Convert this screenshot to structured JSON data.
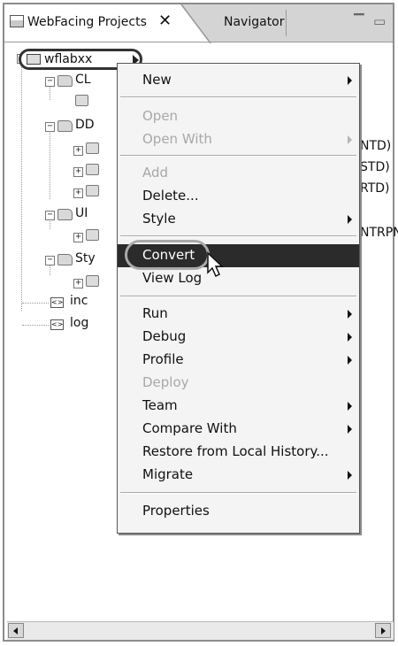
{
  "tabs": {
    "active_label": "WebFacing Projects",
    "close_glyph": "✕",
    "inactive_label": "Navigator",
    "minimize_glyph": "▔",
    "maximize_glyph": "▭"
  },
  "tree": {
    "root_label": "wflabxx",
    "nodes": [
      {
        "label": "CL",
        "icon": "cl-folder-icon"
      },
      {
        "label": "DD",
        "icon": "dds-folder-icon"
      },
      {
        "label": "UI",
        "icon": "ui-folder-icon"
      },
      {
        "label": "Sty",
        "icon": "style-folder-icon"
      },
      {
        "label": "inc",
        "icon": "file-icon"
      },
      {
        "label": "log",
        "icon": "file-icon"
      }
    ],
    "right_fragments": [
      "NTD)",
      "STD)",
      "RTD)",
      "NTRPN"
    ]
  },
  "context_menu": {
    "items": [
      {
        "label": "New",
        "submenu": true,
        "enabled": true
      },
      {
        "label": "Open",
        "submenu": false,
        "enabled": false
      },
      {
        "label": "Open With",
        "submenu": true,
        "enabled": false
      },
      {
        "label": "Add",
        "submenu": false,
        "enabled": false
      },
      {
        "label": "Delete...",
        "submenu": false,
        "enabled": true
      },
      {
        "label": "Style",
        "submenu": true,
        "enabled": true
      },
      {
        "label": "Convert",
        "submenu": false,
        "enabled": true,
        "selected": true
      },
      {
        "label": "View Log",
        "submenu": false,
        "enabled": true
      },
      {
        "label": "Run",
        "submenu": true,
        "enabled": true
      },
      {
        "label": "Debug",
        "submenu": true,
        "enabled": true
      },
      {
        "label": "Profile",
        "submenu": true,
        "enabled": true
      },
      {
        "label": "Deploy",
        "submenu": false,
        "enabled": false
      },
      {
        "label": "Team",
        "submenu": true,
        "enabled": true
      },
      {
        "label": "Compare With",
        "submenu": true,
        "enabled": true
      },
      {
        "label": "Restore from Local History...",
        "submenu": false,
        "enabled": true
      },
      {
        "label": "Migrate",
        "submenu": true,
        "enabled": true
      },
      {
        "label": "Properties",
        "submenu": false,
        "enabled": true
      }
    ]
  },
  "colors": {
    "selection_bg": "#2b2b2b",
    "menu_bg": "#f4f4f4",
    "disabled_text": "#a8a8a8"
  }
}
